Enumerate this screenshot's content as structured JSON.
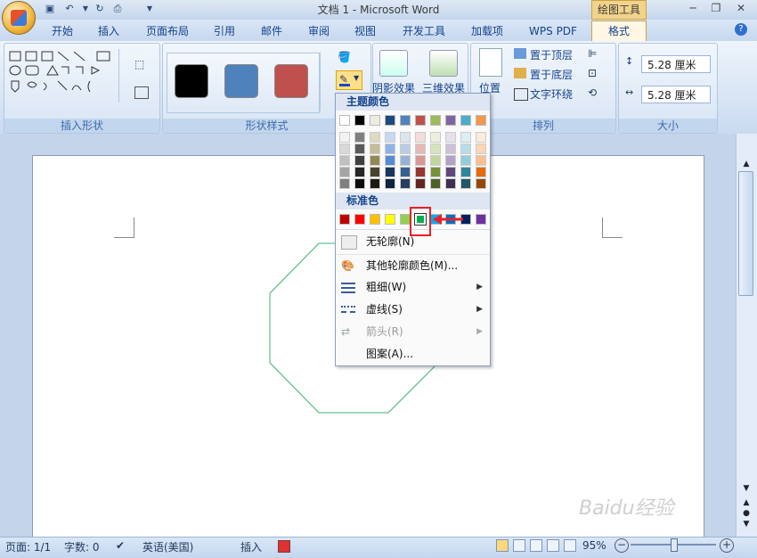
{
  "window": {
    "title": "文档 1 - Microsoft Word",
    "context_tab": "绘图工具"
  },
  "tabs": [
    "开始",
    "插入",
    "页面布局",
    "引用",
    "邮件",
    "审阅",
    "视图",
    "开发工具",
    "加载项",
    "WPS PDF",
    "格式"
  ],
  "active_tab": "格式",
  "ribbon": {
    "groups": {
      "insert_shapes": "插入形状",
      "shape_styles": "形状样式",
      "arrange": "排列",
      "size": "大小"
    },
    "style_swatches": [
      "#000000",
      "#4f81bd",
      "#c0504d"
    ],
    "shadow_effect": "阴影效果",
    "3d_effect": "三维效果",
    "position": "位置",
    "bring_to_front": "置于顶层",
    "send_to_back": "置于底层",
    "text_wrap": "文字环绕",
    "height_value": "5.28 厘米",
    "width_value": "5.28 厘米"
  },
  "dropdown": {
    "theme_colors_header": "主题颜色",
    "standard_colors_header": "标准色",
    "theme_top_row": [
      "#ffffff",
      "#000000",
      "#eeece1",
      "#1f497d",
      "#4f81bd",
      "#c0504d",
      "#9bbb59",
      "#8064a2",
      "#4bacc6",
      "#f79646"
    ],
    "theme_shades": [
      [
        "#f2f2f2",
        "#7f7f7f",
        "#ddd9c3",
        "#c6d9f0",
        "#dbe5f1",
        "#f2dcdb",
        "#ebf1dd",
        "#e5e0ec",
        "#dbeef3",
        "#fdeada"
      ],
      [
        "#d8d8d8",
        "#595959",
        "#c4bd97",
        "#8db3e2",
        "#b8cce4",
        "#e5b9b7",
        "#d7e3bc",
        "#ccc1d9",
        "#b7dde8",
        "#fbd5b5"
      ],
      [
        "#bfbfbf",
        "#3f3f3f",
        "#938953",
        "#548dd4",
        "#95b3d7",
        "#d99694",
        "#c3d69b",
        "#b2a2c7",
        "#92cddc",
        "#fac08f"
      ],
      [
        "#a5a5a5",
        "#262626",
        "#494429",
        "#17365d",
        "#366092",
        "#953734",
        "#76923c",
        "#5f497a",
        "#31859b",
        "#e36c09"
      ],
      [
        "#7f7f7f",
        "#0c0c0c",
        "#1d1b10",
        "#0f243e",
        "#244061",
        "#632423",
        "#4f6128",
        "#3f3151",
        "#205867",
        "#974806"
      ]
    ],
    "standard_colors": [
      "#c00000",
      "#ff0000",
      "#ffc000",
      "#ffff00",
      "#92d050",
      "#00b050",
      "#00b0f0",
      "#0070c0",
      "#002060",
      "#7030a0"
    ],
    "selected_standard_index": 5,
    "highlight_color": "#e8202a",
    "items": [
      {
        "label": "无轮廓(N)",
        "enabled": true,
        "submenu": false,
        "icon": "no-outline-icon"
      },
      {
        "label": "其他轮廓颜色(M)...",
        "enabled": true,
        "submenu": false,
        "icon": "color-palette-icon"
      },
      {
        "label": "粗细(W)",
        "enabled": true,
        "submenu": true,
        "icon": "line-weight-icon"
      },
      {
        "label": "虚线(S)",
        "enabled": true,
        "submenu": true,
        "icon": "dash-icon"
      },
      {
        "label": "箭头(R)",
        "enabled": false,
        "submenu": true,
        "icon": "arrow-icon"
      },
      {
        "label": "图案(A)...",
        "enabled": true,
        "submenu": false,
        "icon": ""
      }
    ]
  },
  "document": {
    "shape": "octagon",
    "outline_color": "#3cb371"
  },
  "statusbar": {
    "page": "页面: 1/1",
    "words": "字数: 0",
    "language": "英语(美国)",
    "insert_mode": "插入",
    "zoom": "95%",
    "zoom_fraction": 0.5
  },
  "watermark": "Baidu经验"
}
